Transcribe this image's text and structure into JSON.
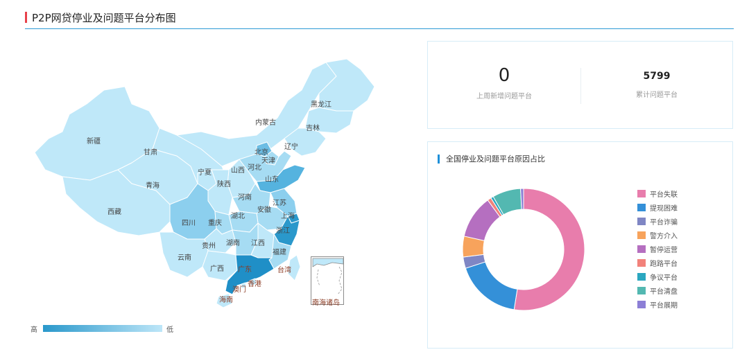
{
  "header": {
    "title": "P2P网贷停业及问题平台分布图"
  },
  "map": {
    "provinces": [
      {
        "name": "新疆",
        "color": "#bfe8f9"
      },
      {
        "name": "西藏",
        "color": "#bfe8f9"
      },
      {
        "name": "青海",
        "color": "#bfe8f9"
      },
      {
        "name": "甘肃",
        "color": "#bfe8f9"
      },
      {
        "name": "内蒙古",
        "color": "#bfe8f9"
      },
      {
        "name": "黑龙江",
        "color": "#bfe8f9"
      },
      {
        "name": "吉林",
        "color": "#bfe8f9"
      },
      {
        "name": "辽宁",
        "color": "#bfe8f9"
      },
      {
        "name": "北京",
        "color": "#6cbde4"
      },
      {
        "name": "天津",
        "color": "#a6dcf3"
      },
      {
        "name": "河北",
        "color": "#a6dcf3"
      },
      {
        "name": "山西",
        "color": "#bfe8f9"
      },
      {
        "name": "宁夏",
        "color": "#bfe8f9"
      },
      {
        "name": "陕西",
        "color": "#bfe8f9"
      },
      {
        "name": "山东",
        "color": "#55b3df"
      },
      {
        "name": "河南",
        "color": "#a6dcf3"
      },
      {
        "name": "江苏",
        "color": "#8ccfee"
      },
      {
        "name": "安徽",
        "color": "#a6dcf3"
      },
      {
        "name": "上海",
        "color": "#2a98cb"
      },
      {
        "name": "浙江",
        "color": "#2a98cb"
      },
      {
        "name": "湖北",
        "color": "#a6dcf3"
      },
      {
        "name": "四川",
        "color": "#8ccfee"
      },
      {
        "name": "重庆",
        "color": "#a6dcf3"
      },
      {
        "name": "贵州",
        "color": "#bfe8f9"
      },
      {
        "name": "湖南",
        "color": "#a6dcf3"
      },
      {
        "name": "江西",
        "color": "#bfe8f9"
      },
      {
        "name": "福建",
        "color": "#a6dcf3"
      },
      {
        "name": "云南",
        "color": "#bfe8f9"
      },
      {
        "name": "广西",
        "color": "#bfe8f9"
      },
      {
        "name": "广东",
        "color": "#1f8fc7"
      },
      {
        "name": "香港",
        "color": "#bfe8f9"
      },
      {
        "name": "澳门",
        "color": "#bfe8f9"
      },
      {
        "name": "台湾",
        "color": "#bfe8f9"
      },
      {
        "name": "海南",
        "color": "#bfe8f9"
      }
    ],
    "inset_label": "南海诸岛",
    "scale": {
      "high": "高",
      "low": "低",
      "color_high": "#2a98cb",
      "color_low": "#bde6f8"
    }
  },
  "stats": {
    "new_count": "0",
    "new_label": "上周新增问题平台",
    "total_count": "5799",
    "total_label": "累计问题平台"
  },
  "pie": {
    "title": "全国停业及问题平台原因占比",
    "legend": [
      "平台失联",
      "提现困难",
      "平台诈骗",
      "警方介入",
      "暂停运营",
      "跑路平台",
      "争议平台",
      "平台清盘",
      "平台展期"
    ]
  },
  "chart_data": {
    "type": "pie",
    "categories": [
      "平台失联",
      "提现困难",
      "平台诈骗",
      "警方介入",
      "暂停运营",
      "跑路平台",
      "争议平台",
      "平台清盘",
      "平台展期"
    ],
    "values": [
      52.5,
      17.5,
      3.0,
      5.5,
      11.5,
      1.0,
      0.7,
      7.5,
      0.8
    ],
    "colors": [
      "#e87dac",
      "#3490d8",
      "#7f86c4",
      "#f7a35c",
      "#b56fc0",
      "#f2827b",
      "#2ba7c0",
      "#53b8b1",
      "#8c7fd6"
    ],
    "donut": true,
    "legend_position": "right"
  }
}
